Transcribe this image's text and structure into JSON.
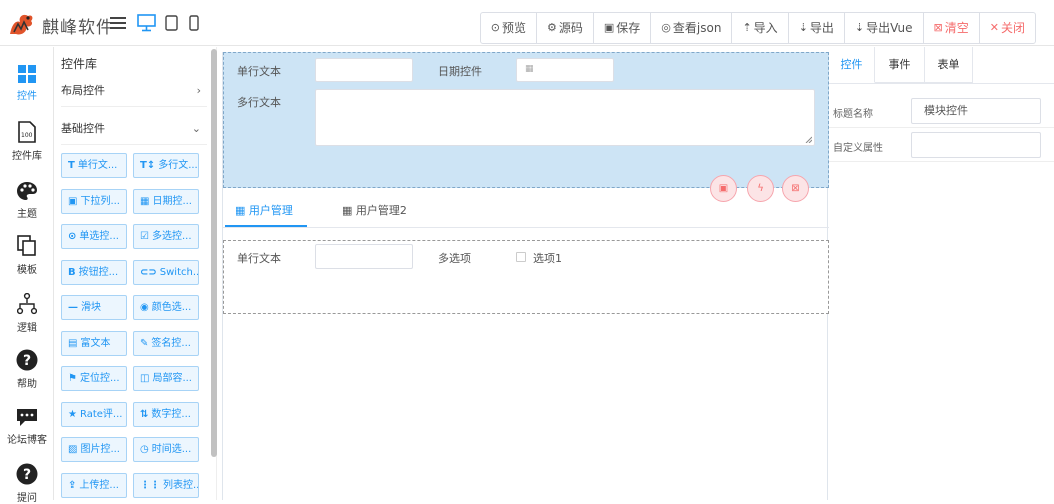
{
  "brand": {
    "name": "麒峰软件"
  },
  "toolbar": {
    "buttons": [
      {
        "icon": "⊙",
        "label": "预览"
      },
      {
        "icon": "⚙",
        "label": "源码"
      },
      {
        "icon": "▣",
        "label": "保存"
      },
      {
        "icon": "◎",
        "label": "查看json"
      },
      {
        "icon": "⇡",
        "label": "导入"
      },
      {
        "icon": "⇣",
        "label": "导出"
      },
      {
        "icon": "⇣",
        "label": "导出Vue"
      },
      {
        "icon": "⊠",
        "label": "清空"
      },
      {
        "icon": "✕",
        "label": "关闭"
      }
    ]
  },
  "leftnav": {
    "items": [
      {
        "label": "控件"
      },
      {
        "label": "控件库"
      },
      {
        "label": "主题"
      },
      {
        "label": "模板"
      },
      {
        "label": "逻辑"
      },
      {
        "label": "帮助"
      },
      {
        "label": "论坛博客"
      },
      {
        "label": "提问"
      }
    ]
  },
  "panel": {
    "title": "控件库",
    "sections": [
      {
        "label": "布局控件",
        "chevron": "›"
      },
      {
        "label": "基础控件",
        "chevron": "⌄"
      }
    ],
    "components": [
      {
        "icon": "T",
        "label": "单行文..."
      },
      {
        "icon": "T↕",
        "label": "多行文..."
      },
      {
        "icon": "▣",
        "label": "下拉列..."
      },
      {
        "icon": "▦",
        "label": "日期控..."
      },
      {
        "icon": "⊙",
        "label": "单选控..."
      },
      {
        "icon": "☑",
        "label": "多选控..."
      },
      {
        "icon": "B",
        "label": "按钮控..."
      },
      {
        "icon": "⊂⊃",
        "label": "Switch..."
      },
      {
        "icon": "—",
        "label": "滑块"
      },
      {
        "icon": "◉",
        "label": "颜色选..."
      },
      {
        "icon": "▤",
        "label": "富文本"
      },
      {
        "icon": "✎",
        "label": "签名控..."
      },
      {
        "icon": "⚑",
        "label": "定位控..."
      },
      {
        "icon": "◫",
        "label": "局部容..."
      },
      {
        "icon": "★",
        "label": "Rate评..."
      },
      {
        "icon": "⇅",
        "label": "数字控..."
      },
      {
        "icon": "▨",
        "label": "图片控..."
      },
      {
        "icon": "◷",
        "label": "时间选..."
      },
      {
        "icon": "⇪",
        "label": "上传控..."
      },
      {
        "icon": "⋮⋮",
        "label": "列表控..."
      }
    ]
  },
  "canvas": {
    "block1": {
      "field1_label": "单行文本",
      "field2_label": "日期控件",
      "field3_label": "多行文本"
    },
    "tabs": [
      {
        "label": "用户管理",
        "active": true
      },
      {
        "label": "用户管理2",
        "active": false
      }
    ],
    "block2": {
      "field1_label": "单行文本",
      "field2_label": "多选项",
      "option1": "选项1"
    }
  },
  "props": {
    "tabs": [
      {
        "label": "控件"
      },
      {
        "label": "事件"
      },
      {
        "label": "表单"
      }
    ],
    "rows": [
      {
        "label": "标题名称",
        "value": "模块控件"
      },
      {
        "label": "自定义属性",
        "value": ""
      }
    ]
  },
  "colors": {
    "accent": "#2196f3",
    "danger": "#f56c6c",
    "selected_block": "#cde4f5"
  }
}
